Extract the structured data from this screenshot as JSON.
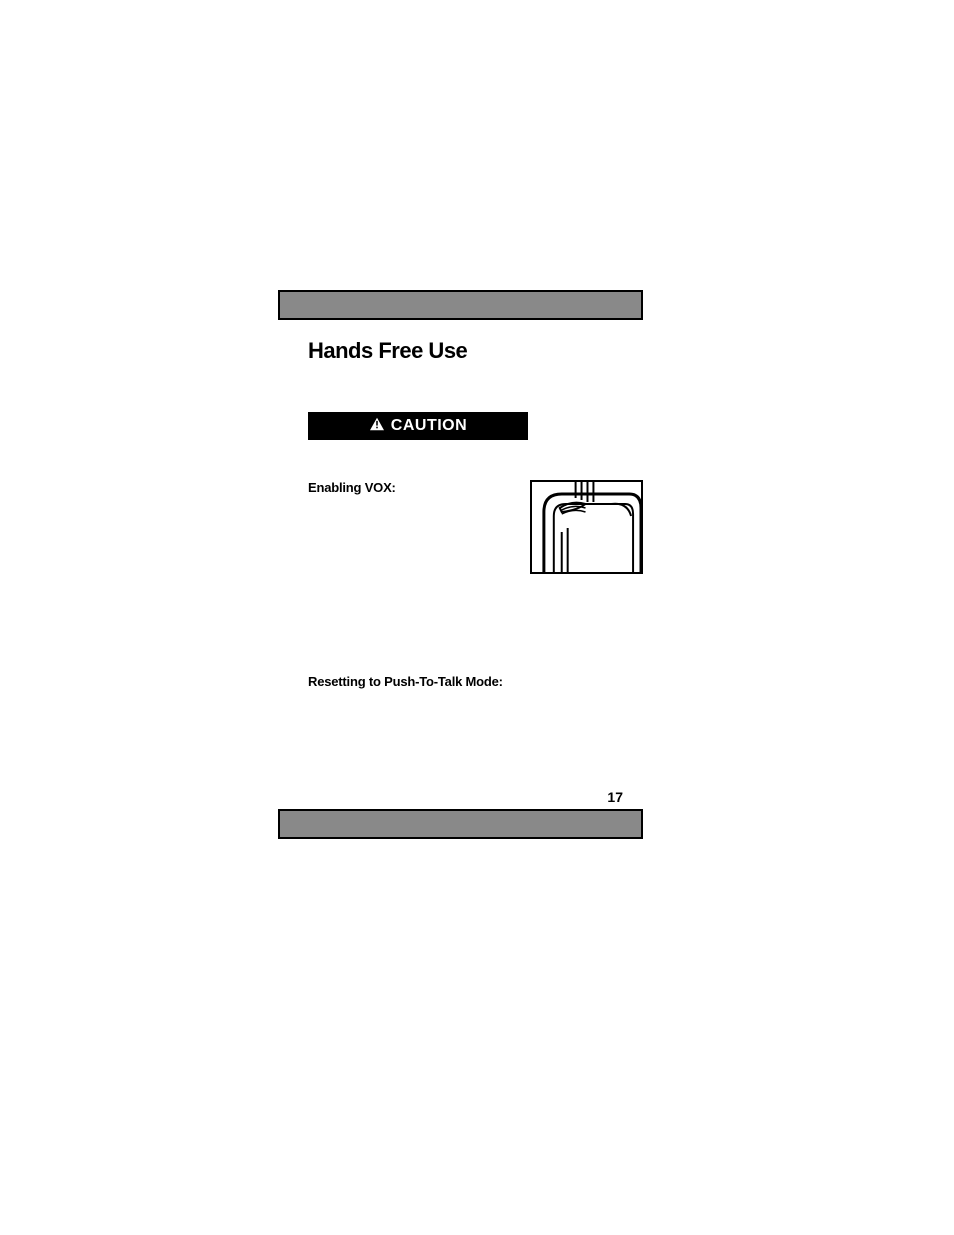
{
  "title": "Hands Free Use",
  "caution_label": "CAUTION",
  "sections": {
    "enable_vox": "Enabling VOX:",
    "reset_ptt": "Resetting to Push-To-Talk Mode:"
  },
  "page_number": "17"
}
